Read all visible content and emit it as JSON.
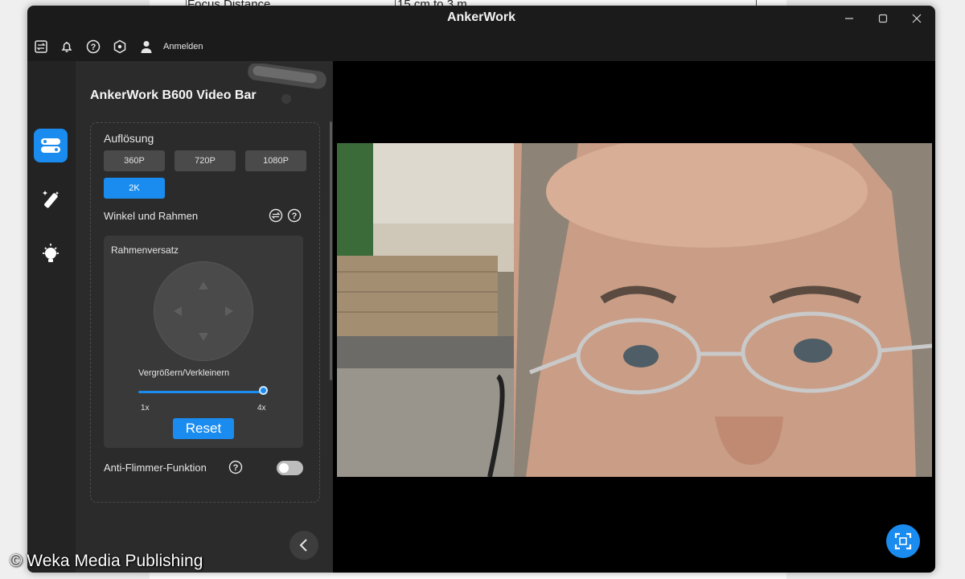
{
  "background_doc": {
    "cell_left": "Focus Distance",
    "cell_right": "15 cm to 3 m"
  },
  "window": {
    "title": "AnkerWork",
    "controls": [
      "minimize-icon",
      "maximize-icon",
      "close-icon"
    ]
  },
  "toolbar": {
    "icons": [
      "switch-icon",
      "bell-icon",
      "help-icon",
      "settings-hex-icon",
      "user-icon"
    ],
    "login_label": "Anmelden"
  },
  "sidebar": {
    "items": [
      {
        "icon": "video-settings-icon",
        "active": true
      },
      {
        "icon": "magic-wand-icon",
        "active": false
      },
      {
        "icon": "lightbulb-icon",
        "active": false
      }
    ]
  },
  "panel": {
    "device_title": "AnkerWork B600 Video Bar",
    "resolution": {
      "label": "Auflösung",
      "options": [
        "360P",
        "720P",
        "1080P",
        "2K"
      ],
      "selected": "2K"
    },
    "angle_frame_label": "Winkel und Rahmen",
    "frame_offset_label": "Rahmenversatz",
    "zoom": {
      "label": "Vergrößern/Verkleinern",
      "min_label": "1x",
      "max_label": "4x",
      "value_fraction": 1.0
    },
    "reset_label": "Reset",
    "anti_flicker": {
      "label": "Anti-Flimmer-Funktion",
      "enabled": false
    }
  },
  "colors": {
    "accent": "#1a8cf0",
    "panel_bg": "#2b2b2b",
    "window_bg": "#1b1b1b"
  },
  "watermark": "© Weka Media Publishing"
}
